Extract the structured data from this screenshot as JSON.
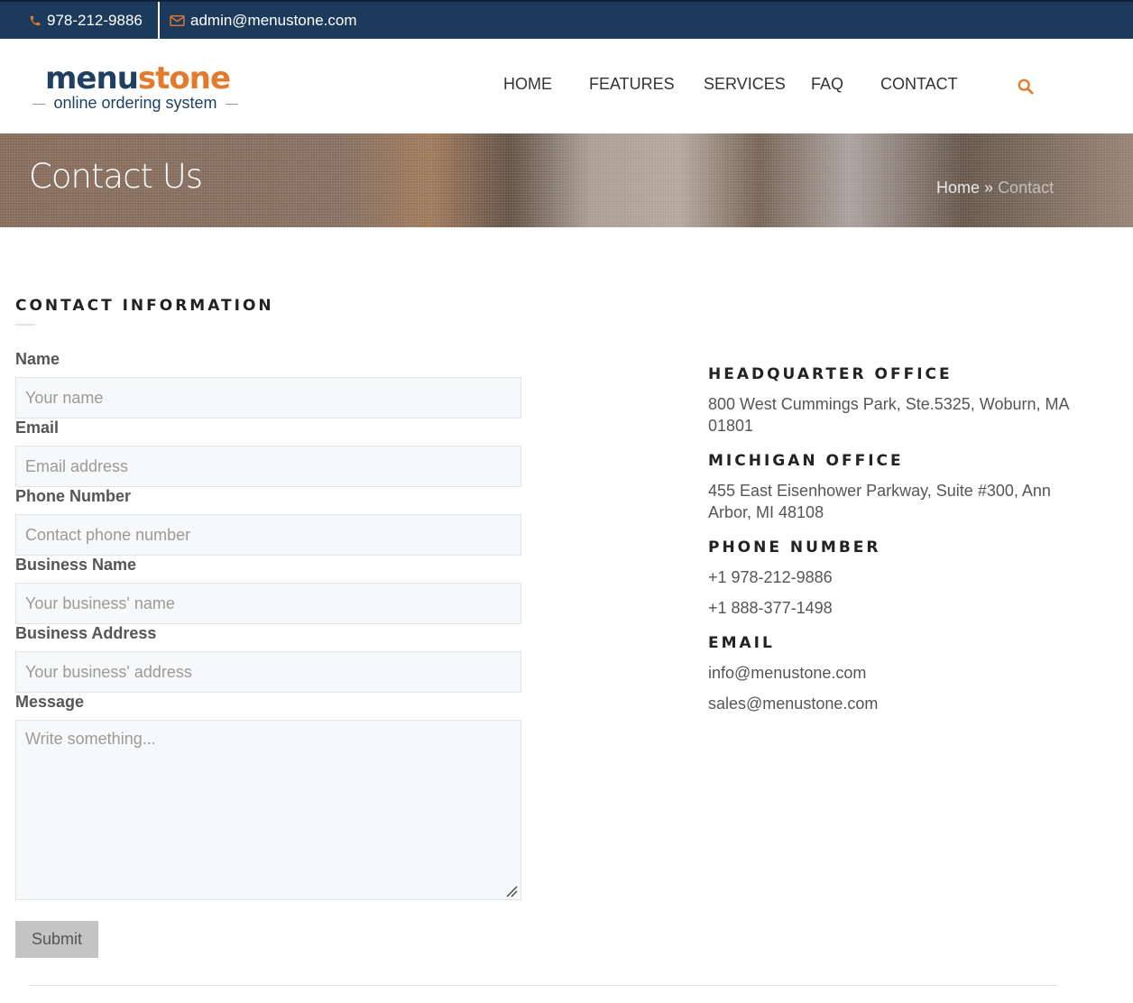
{
  "topbar": {
    "phone": "978-212-9886",
    "email": "admin@menustone.com",
    "phone_icon": "phone-icon",
    "email_icon": "envelope-icon"
  },
  "logo": {
    "word_part1": "menu",
    "word_part2": "stone",
    "tagline": "online ordering system"
  },
  "nav": {
    "items": [
      "HOME",
      "FEATURES",
      "SERVICES",
      "FAQ",
      "CONTACT"
    ],
    "search_icon": "search-icon"
  },
  "banner": {
    "title": "Contact Us",
    "breadcrumb_home": "Home",
    "breadcrumb_sep": "»",
    "breadcrumb_current": "Contact"
  },
  "form": {
    "section_title": "CONTACT INFORMATION",
    "fields": [
      {
        "label": "Name",
        "placeholder": "Your name"
      },
      {
        "label": "Email",
        "placeholder": "Email address"
      },
      {
        "label": "Phone Number",
        "placeholder": "Contact phone number"
      },
      {
        "label": "Business Name",
        "placeholder": "Your business' name"
      },
      {
        "label": "Business Address",
        "placeholder": "Your business' address"
      },
      {
        "label": "Message",
        "placeholder": "Write something..."
      }
    ],
    "submit_label": "Submit"
  },
  "info": {
    "hq_title": "HEADQUARTER OFFICE",
    "hq_address": "800 West Cummings Park, Ste.5325, Woburn, MA 01801",
    "mi_title": "MICHIGAN OFFICE",
    "mi_address": "455 East Eisenhower Parkway, Suite #300, Ann Arbor, MI 48108",
    "phone_title": "PHONE NUMBER",
    "phones": [
      "+1 978-212-9886",
      "+1 888-377-1498"
    ],
    "email_title": "EMAIL",
    "emails": [
      "info@menustone.com",
      "sales@menustone.com"
    ]
  },
  "colors": {
    "topbar_bg": "#1c3a5c",
    "accent": "#e47a2c",
    "brand_blue": "#1f3f63"
  }
}
